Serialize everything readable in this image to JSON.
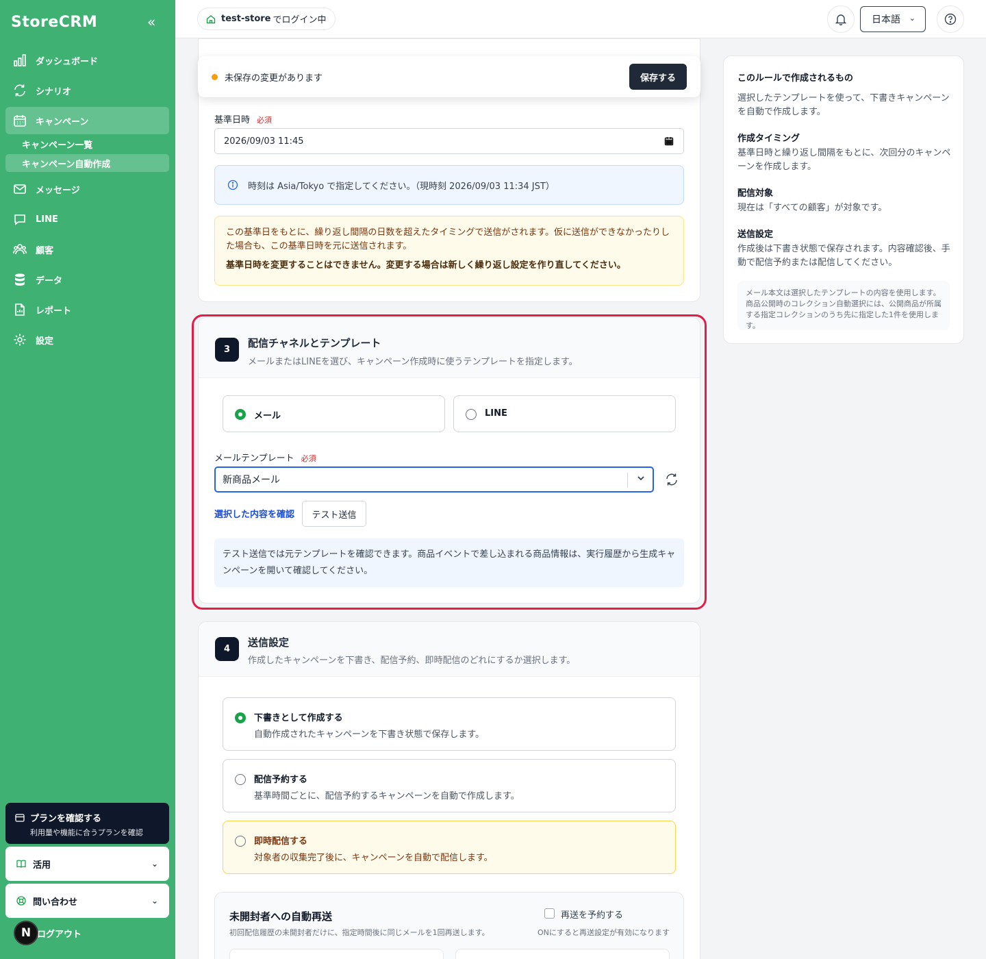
{
  "sidebar": {
    "logo": "StoreCRM",
    "collapse_glyph": "«",
    "items": [
      {
        "label": "ダッシュボード",
        "icon": "bar-chart-icon"
      },
      {
        "label": "シナリオ",
        "icon": "refresh-icon"
      },
      {
        "label": "キャンペーン",
        "icon": "calendar-icon",
        "active": true
      },
      {
        "label": "メッセージ",
        "icon": "mail-icon"
      },
      {
        "label": "LINE",
        "icon": "chat-icon"
      },
      {
        "label": "顧客",
        "icon": "users-icon"
      },
      {
        "label": "データ",
        "icon": "database-icon"
      },
      {
        "label": "レポート",
        "icon": "file-icon"
      },
      {
        "label": "設定",
        "icon": "gear-icon"
      }
    ],
    "subitems": [
      {
        "label": "キャンペーン一覧"
      },
      {
        "label": "キャンペーン自動作成",
        "active": true
      }
    ],
    "plan": {
      "title": "プランを確認する",
      "subtitle": "利用量や機能に合うプランを確認"
    },
    "accordions": [
      {
        "label": "活用"
      },
      {
        "label": "問い合わせ"
      }
    ],
    "avatar_letter": "N",
    "logout": "ログアウト"
  },
  "topbar": {
    "store": "test-store",
    "store_suffix": "でログイン中",
    "language": "日本語"
  },
  "savebar": {
    "status": "未保存の変更があります",
    "save_label": "保存する"
  },
  "schedule": {
    "base_label": "基準日時",
    "required": "必須",
    "base_value": "2026/09/03 11:45",
    "tz_info": "時刻は Asia/Tokyo で指定してください。（現時刻 2026/09/03 11:34 JST）",
    "warn_text": "この基準日をもとに、繰り返し間隔の日数を超えたタイミングで送信がされます。仮に送信ができなかったりした場合も、この基準日時を元に送信されます。",
    "warn_strong": "基準日時を変更することはできません。変更する場合は新しく繰り返し設定を作り直してください。"
  },
  "section3": {
    "step": "3",
    "title": "配信チャネルとテンプレート",
    "desc": "メールまたはLINEを選び、キャンペーン作成時に使うテンプレートを指定します。",
    "channels": [
      {
        "label": "メール",
        "selected": true
      },
      {
        "label": "LINE",
        "selected": false
      }
    ],
    "template_label": "メールテンプレート",
    "required": "必須",
    "template_value": "新商品メール",
    "confirm_link": "選択した内容を確認",
    "test_button": "テスト送信",
    "note": "テスト送信では元テンプレートを確認できます。商品イベントで差し込まれる商品情報は、実行履歴から生成キャンペーンを開いて確認してください。"
  },
  "section4": {
    "step": "4",
    "title": "送信設定",
    "desc": "作成したキャンペーンを下書き、配信予約、即時配信のどれにするか選択します。",
    "options": [
      {
        "title": "下書きとして作成する",
        "desc": "自動作成されたキャンペーンを下書き状態で保存します。",
        "selected": true
      },
      {
        "title": "配信予約する",
        "desc": "基準時間ごとに、配信予約するキャンペーンを自動で作成します。",
        "selected": false
      },
      {
        "title": "即時配信する",
        "desc": "対象者の収集完了後に、キャンペーンを自動で配信します。",
        "selected": false
      }
    ],
    "resend": {
      "title": "未開封者への自動再送",
      "desc": "初回配信履歴の未開封者だけに、指定時間後に同じメールを1回再送します。",
      "checkbox_label": "再送を予約する",
      "checkbox_hint": "ONにすると再送設定が有効になります"
    }
  },
  "right_panel": {
    "heading": "このルールで作成されるもの",
    "intro": "選択したテンプレートを使って、下書きキャンペーンを自動で作成します。",
    "blocks": [
      {
        "title": "作成タイミング",
        "text": "基準日時と繰り返し間隔をもとに、次回分のキャンペーンを作成します。"
      },
      {
        "title": "配信対象",
        "text": "現在は「すべての顧客」が対象です。"
      },
      {
        "title": "送信設定",
        "text": "作成後は下書き状態で保存されます。内容確認後、手動で配信予約または配信してください。"
      }
    ],
    "note": "メール本文は選択したテンプレートの内容を使用します。商品公開時のコレクション自動選択には、公開商品が所属する指定コレクションのうち先に指定した1件を使用します。"
  },
  "colors": {
    "sidebar": "#3fb273",
    "primary_dark": "#1f2937",
    "accent_highlight": "#e11d48",
    "radio_on": "#16a34a",
    "link": "#1d4ed8"
  }
}
